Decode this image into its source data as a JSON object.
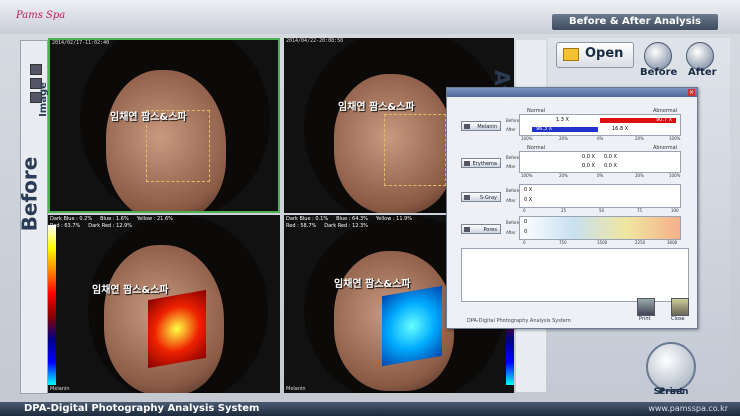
{
  "app": {
    "logo_text": "Pams Spa",
    "title": "Before & After Analysis",
    "footer_title": "DPA-Digital Photography Analysis System",
    "footer_url": "www.pamsspa.co.kr"
  },
  "left_sidebar": {
    "section_label": "Before",
    "image_label": "Image"
  },
  "after_label": "After",
  "right_toolbar": {
    "open_label": "Open",
    "before_label": "Before",
    "after_label": "After",
    "screen_print_label_1": "Screen",
    "screen_print_label_2": "Print"
  },
  "panels": {
    "top_left": {
      "timestamp": "2014/02/17-11:02:40",
      "watermark": "임채연 팜스&스파"
    },
    "top_right": {
      "timestamp": "2014/04/22-20:08:50",
      "watermark": "임채연 팜스&스파"
    },
    "bottom_left": {
      "watermark": "임채연 팜스&스파",
      "stat_1": "Dark Blue : 0.2%",
      "stat_2": "Blue : 1.6%",
      "stat_3": "Yellow : 21.6%",
      "stat_4": "Red : 63.7%",
      "stat_5": "Dark Red : 12.9%",
      "caption": "Melanin"
    },
    "bottom_right": {
      "watermark": "임채연 팜스&스파",
      "stat_1": "Dark Blue : 0.1%",
      "stat_2": "Blue : 64.3%",
      "stat_3": "Yellow : 11.9%",
      "stat_4": "Red : 58.7%",
      "stat_5": "Dark Red : 12.3%",
      "caption": "Melanin"
    }
  },
  "dialog": {
    "footer": "DPA-Digital Photography Analysis System",
    "print_label": "Print",
    "close_label": "Close",
    "normal_label": "Normal",
    "abnormal_label": "Abnormal",
    "before_label": "Before",
    "after_label": "After",
    "metrics": [
      {
        "name": "Melanin",
        "before_value": "1.3 X",
        "before_right": "90.7 X",
        "after_left": "96.3 X",
        "after_value": "16.8 X",
        "before_normal_pct": 0.5,
        "before_abnormal_pct": 0.75,
        "after_normal_pct": 0.55,
        "after_abnormal_pct": 0.0,
        "axis": [
          "100%",
          "20%",
          "0%",
          "20%",
          "100%"
        ]
      },
      {
        "name": "Erythema",
        "before_value": "0.0 X",
        "before_right": "0.0 X",
        "after_left": "0.0 X",
        "after_value": "0.0 X",
        "axis": [
          "100%",
          "20%",
          "0%",
          "20%",
          "100%"
        ]
      },
      {
        "name": "S-Gray",
        "before_value": "0 X",
        "after_value": "0 X",
        "axis": [
          "0",
          "25",
          "50",
          "75",
          "100"
        ]
      },
      {
        "name": "Pores",
        "before_value": "0",
        "after_value": "0",
        "axis": [
          "0",
          "750",
          "1500",
          "2250",
          "3000"
        ]
      }
    ]
  },
  "colors": {
    "accent": "#3c4a5c",
    "normal_bar": "#2233cc",
    "abnormal_bar": "#dd1111"
  }
}
